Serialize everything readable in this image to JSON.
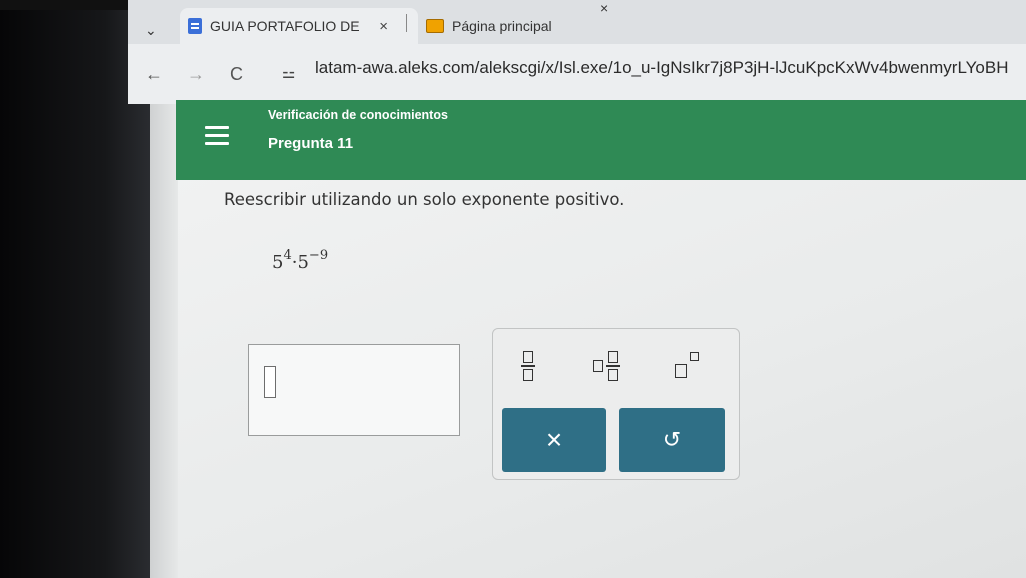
{
  "browser": {
    "tab_dropdown_icon": "chevron-down-icon",
    "tabs": [
      {
        "label": "GUIA PORTAFOLIO DE",
        "icon": "docs-icon",
        "close": "×"
      },
      {
        "label": "Página principal",
        "icon": "image-icon",
        "close": "×"
      }
    ],
    "nav": {
      "back": "←",
      "forward": "→",
      "reload": "C",
      "site_info": "⚍"
    },
    "url": "latam-awa.aleks.com/alekscgi/x/Isl.exe/1o_u-IgNsIkr7j8P3jH-lJcuKpcKxWv4bwenmyrLYoBH"
  },
  "header": {
    "title": "Verificación de conocimientos",
    "question_label": "Pregunta 11",
    "brand_color": "#2f8a55"
  },
  "question": {
    "instruction": "Reescribir utilizando un solo exponente positivo.",
    "expression": {
      "base1": "5",
      "exp1": "4",
      "dot": "·",
      "base2": "5",
      "exp2": "−9"
    }
  },
  "palette": {
    "buttons": [
      "fraction-icon",
      "mixed-number-icon",
      "exponent-icon"
    ],
    "clear_label": "×",
    "undo_label": "↺",
    "button_color": "#2f6f86"
  }
}
